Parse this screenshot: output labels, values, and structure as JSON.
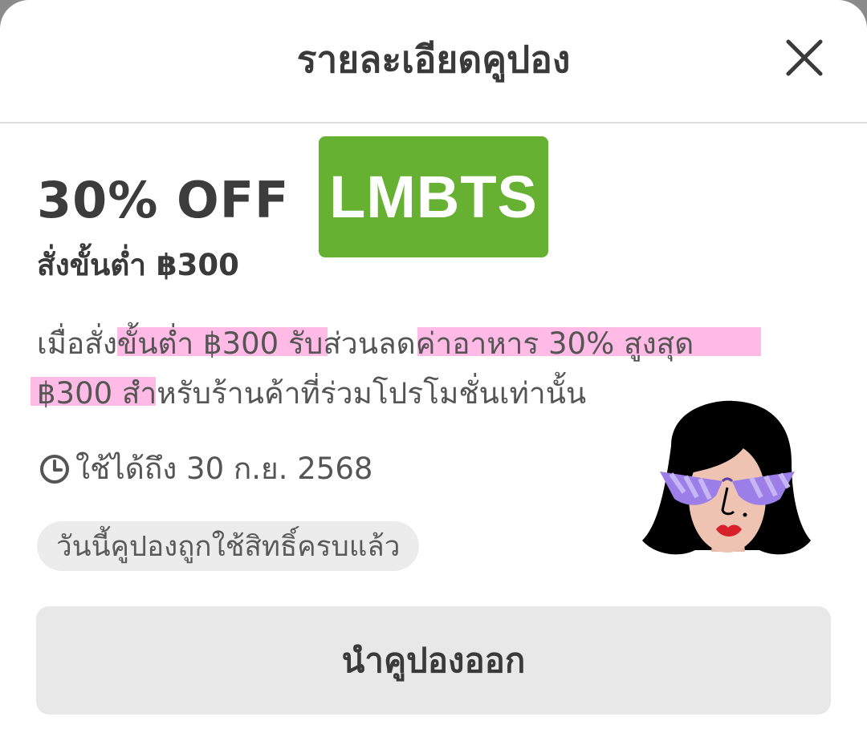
{
  "header": {
    "title": "รายละเอียดคูปอง",
    "close_icon": "close-icon"
  },
  "coupon": {
    "discount": "30% OFF",
    "min_order": "สั่งขั้นต่ำ ฿300",
    "code": "LMBTS",
    "code_badge_color": "#66b032",
    "description_line1": "เมื่อสั่งขั้นต่ำ ฿300 รับส่วนลดค่าอาหาร 30% สูงสุด",
    "description_line2": "฿300 สำหรับร้านค้าที่ร่วมโปรโมชั่นเท่านั้น",
    "validity": "ใช้ได้ถึง 30 ก.ย. 2568",
    "validity_icon": "clock-icon",
    "status": "วันนี้คูปองถูกใช้สิทธิ์ครบแล้ว",
    "highlight_color": "#ff69c8"
  },
  "actions": {
    "remove_label": "นำคูปองออก"
  },
  "sticker": {
    "icon": "woman-sunglasses-sticker"
  }
}
